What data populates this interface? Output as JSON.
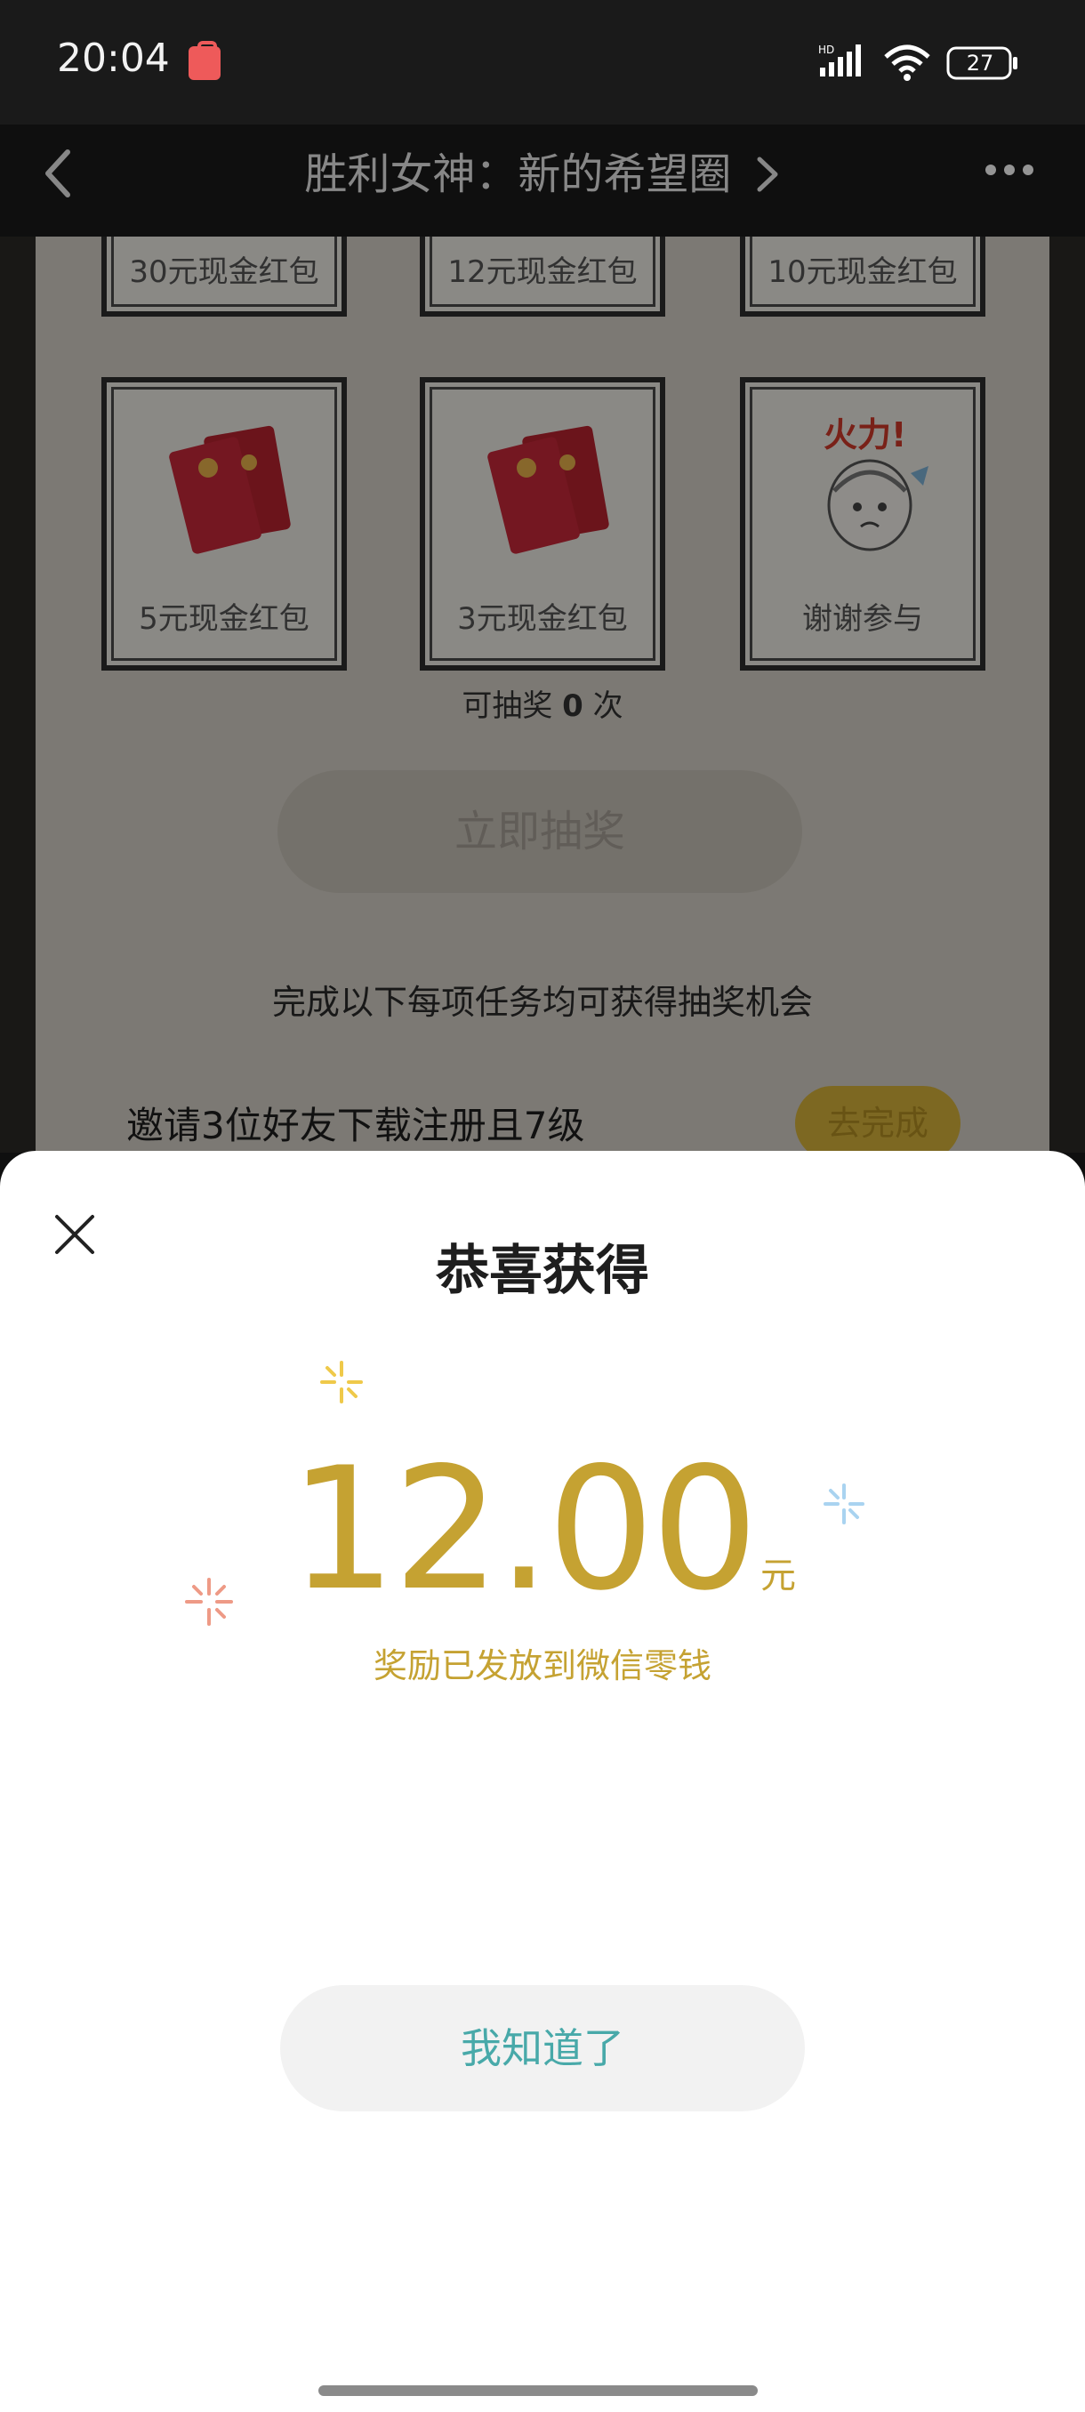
{
  "status_bar": {
    "time": "20:04",
    "battery": "27",
    "network": "HD"
  },
  "nav": {
    "title": "胜利女神：新的希望圈"
  },
  "background_page": {
    "prizes_top_row": [
      "30元现金红包",
      "12元现金红包",
      "10元现金红包"
    ],
    "prizes_second_row": [
      "5元现金红包",
      "3元现金红包",
      "谢谢参与"
    ],
    "draw_count_prefix": "可抽奖 ",
    "draw_count_value": "0",
    "draw_count_suffix": " 次",
    "draw_button": "立即抽奖",
    "task_intro": "完成以下每项任务均可获得抽奖机会",
    "task_label": "邀请3位好友下载注册且7级",
    "task_button": "去完成",
    "sticker_text": "火力!"
  },
  "dialog": {
    "title": "恭喜获得",
    "amount": "12.00",
    "unit": "元",
    "note": "奖励已发放到微信零钱",
    "confirm": "我知道了"
  },
  "colors": {
    "gold": "#c5a232",
    "teal": "#48a9a9",
    "red_packet": "#c8293a"
  }
}
